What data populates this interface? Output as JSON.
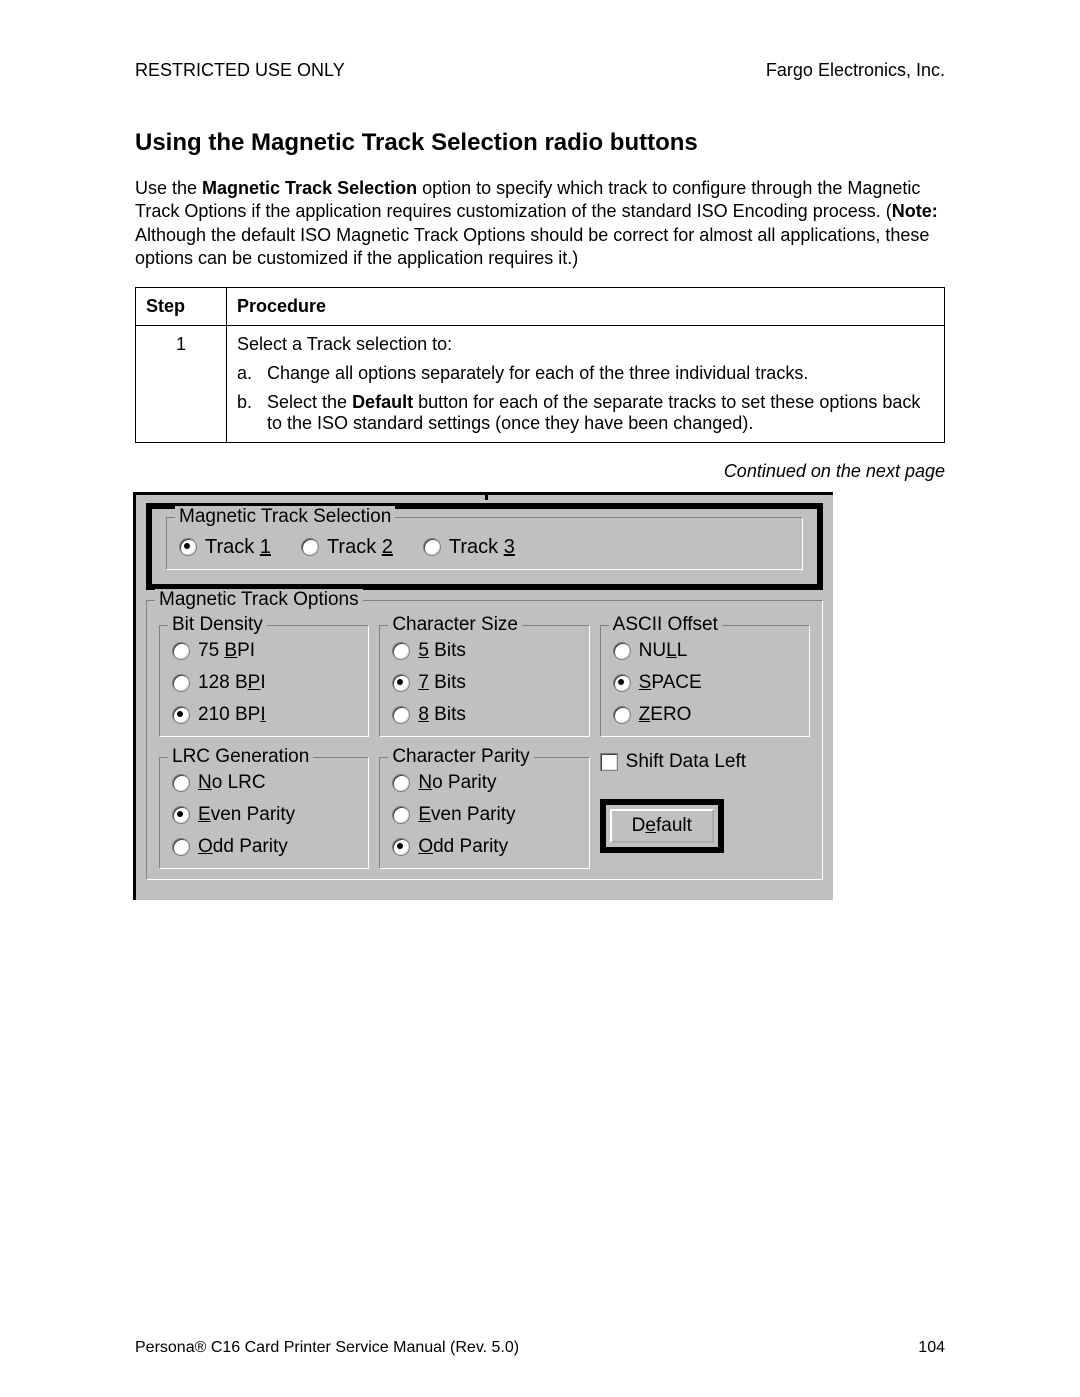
{
  "header": {
    "left": "RESTRICTED USE ONLY",
    "right": "Fargo Electronics, Inc."
  },
  "section_title": "Using the Magnetic Track Selection radio buttons",
  "paragraph": {
    "pre": "Use the ",
    "bold1": "Magnetic Track Selection",
    "mid": " option to specify which track to configure through the Magnetic Track Options if the application requires customization of the standard ISO Encoding process. (",
    "bold2": "Note:",
    "post": "  Although the default ISO Magnetic Track Options should be correct for almost all applications, these options can be customized if the application requires it.)"
  },
  "table": {
    "head_step": "Step",
    "head_proc": "Procedure",
    "step_num": "1",
    "intro": "Select a Track selection to:",
    "items": [
      {
        "marker": "a.",
        "pre": "Change all options separately for each of the three individual tracks.",
        "bold": "",
        "post": ""
      },
      {
        "marker": "b.",
        "pre": "Select the ",
        "bold": "Default",
        "post": " button for each of the separate tracks to set these options back to the ISO standard settings (once they have been changed)."
      }
    ]
  },
  "continued": "Continued on the next page",
  "dialog": {
    "track_selection": {
      "legend": "Magnetic Track Selection",
      "tracks": [
        {
          "label_pre": "Track ",
          "u": "1",
          "selected": true
        },
        {
          "label_pre": "Track ",
          "u": "2",
          "selected": false
        },
        {
          "label_pre": "Track ",
          "u": "3",
          "selected": false
        }
      ]
    },
    "options_legend": "Magnetic Track Options",
    "bit_density": {
      "legend": "Bit Density",
      "items": [
        {
          "pre": "  75 ",
          "u": "B",
          "post": "PI",
          "selected": false
        },
        {
          "pre": "128 B",
          "u": "P",
          "post": "I",
          "selected": false
        },
        {
          "pre": "210 BP",
          "u": "I",
          "post": "",
          "selected": true
        }
      ]
    },
    "char_size": {
      "legend": "Character Size",
      "items": [
        {
          "u": "5",
          "post": " Bits",
          "selected": false
        },
        {
          "u": "7",
          "post": " Bits",
          "selected": true
        },
        {
          "u": "8",
          "post": " Bits",
          "selected": false
        }
      ]
    },
    "ascii_offset": {
      "legend": "ASCII Offset",
      "items": [
        {
          "pre": "NU",
          "u": "L",
          "post": "L",
          "selected": false
        },
        {
          "u": "S",
          "post": "PACE",
          "selected": true
        },
        {
          "u": "Z",
          "post": "ERO",
          "selected": false
        }
      ]
    },
    "lrc": {
      "legend": "LRC Generation",
      "items": [
        {
          "u": "N",
          "post": "o LRC",
          "selected": false
        },
        {
          "u": "E",
          "post": "ven Parity",
          "selected": true
        },
        {
          "u": "O",
          "post": "dd Parity",
          "selected": false
        }
      ]
    },
    "char_parity": {
      "legend": "Character Parity",
      "items": [
        {
          "u": "N",
          "post": "o Parity",
          "selected": false
        },
        {
          "u": "E",
          "post": "ven Parity",
          "selected": false
        },
        {
          "u": "O",
          "post": "dd Parity",
          "selected": true
        }
      ]
    },
    "shift_label": "Shift Data Left",
    "default_btn": {
      "pre": "D",
      "u": "e",
      "post": "fault"
    }
  },
  "footer": {
    "left": "Persona® C16 Card Printer Service Manual (Rev. 5.0)",
    "page": "104"
  }
}
